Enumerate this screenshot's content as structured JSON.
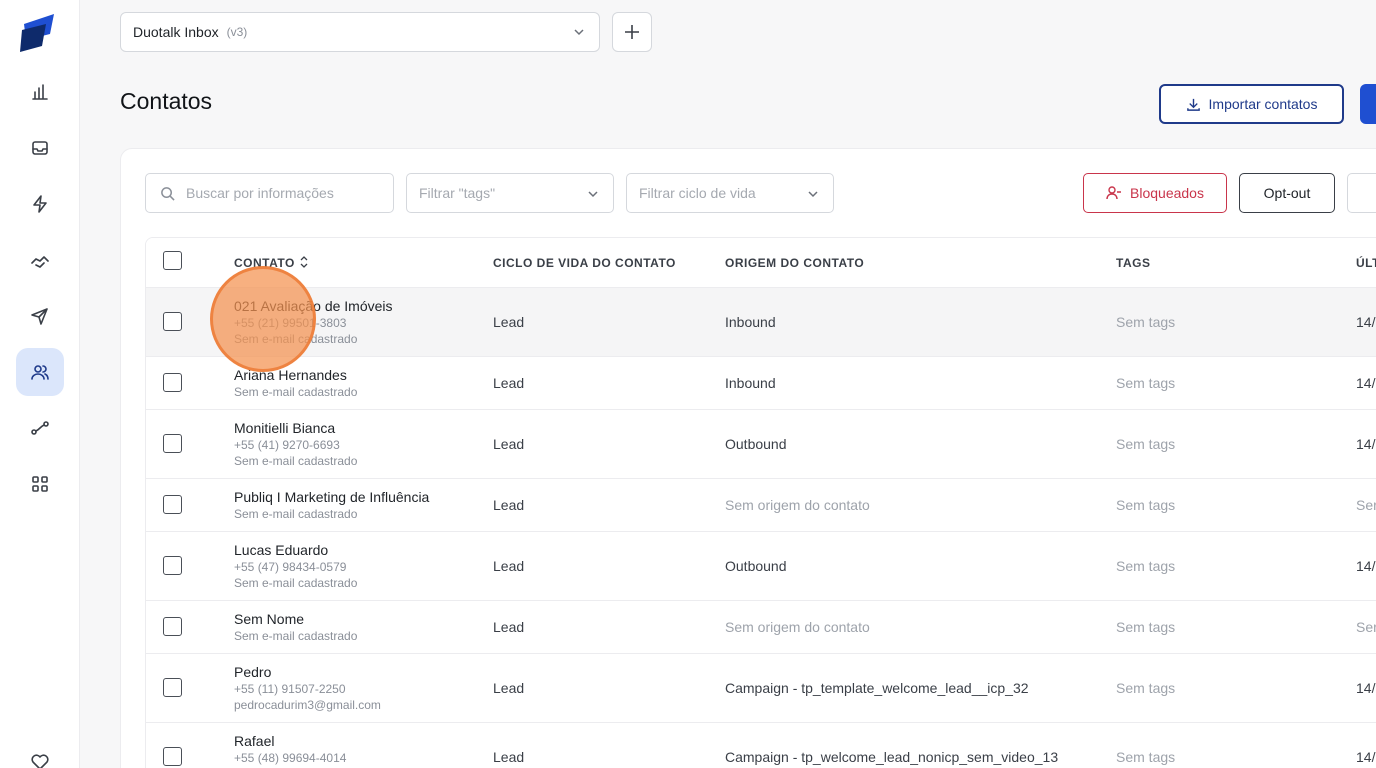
{
  "inbox": {
    "name": "Duotalk Inbox",
    "version": "(v3)"
  },
  "page": {
    "title": "Contatos"
  },
  "actions": {
    "import_label": "Importar contatos"
  },
  "filters": {
    "search_placeholder": "Buscar por informações",
    "tags_placeholder": "Filtrar \"tags\"",
    "lifecycle_placeholder": "Filtrar ciclo de vida",
    "blocked_label": "Bloqueados",
    "optout_label": "Opt-out"
  },
  "table": {
    "headers": [
      "CONTATO",
      "CICLO DE VIDA DO CONTATO",
      "ORIGEM DO CONTATO",
      "TAGS",
      "ÚLT"
    ],
    "rows": [
      {
        "name": "021 Avaliação de Imóveis",
        "phone": "+55 (21) 99501-3803",
        "email": "Sem e-mail cadastrado",
        "lifecycle": "Lead",
        "origin": "Inbound",
        "tags": "Sem tags",
        "last": "14/"
      },
      {
        "name": "Ariana Hernandes",
        "phone": "",
        "email": "Sem e-mail cadastrado",
        "lifecycle": "Lead",
        "origin": "Inbound",
        "tags": "Sem tags",
        "last": "14/"
      },
      {
        "name": "Monitielli Bianca",
        "phone": "+55 (41) 9270-6693",
        "email": "Sem e-mail cadastrado",
        "lifecycle": "Lead",
        "origin": "Outbound",
        "tags": "Sem tags",
        "last": "14/"
      },
      {
        "name": "Publiq I Marketing de Influência",
        "phone": "",
        "email": "Sem e-mail cadastrado",
        "lifecycle": "Lead",
        "origin": "Sem origem do contato",
        "tags": "Sem tags",
        "last": "Ser"
      },
      {
        "name": "Lucas Eduardo",
        "phone": "+55 (47) 98434-0579",
        "email": "Sem e-mail cadastrado",
        "lifecycle": "Lead",
        "origin": "Outbound",
        "tags": "Sem tags",
        "last": "14/"
      },
      {
        "name": "Sem Nome",
        "phone": "",
        "email": "Sem e-mail cadastrado",
        "lifecycle": "Lead",
        "origin": "Sem origem do contato",
        "tags": "Sem tags",
        "last": "Ser"
      },
      {
        "name": "Pedro",
        "phone": "+55 (11) 91507-2250",
        "email": "pedrocadurim3@gmail.com",
        "lifecycle": "Lead",
        "origin": "Campaign - tp_template_welcome_lead__icp_32",
        "tags": "Sem tags",
        "last": "14/"
      },
      {
        "name": "Rafael",
        "phone": "+55 (48) 99694-4014",
        "email": "",
        "lifecycle": "Lead",
        "origin": "Campaign - tp_welcome_lead_nonicp_sem_video_13",
        "tags": "Sem tags",
        "last": "14/"
      }
    ]
  },
  "colors": {
    "primary": "#1f3a8a",
    "danger": "#c9354b",
    "active_nav": "#dbe6fb"
  }
}
